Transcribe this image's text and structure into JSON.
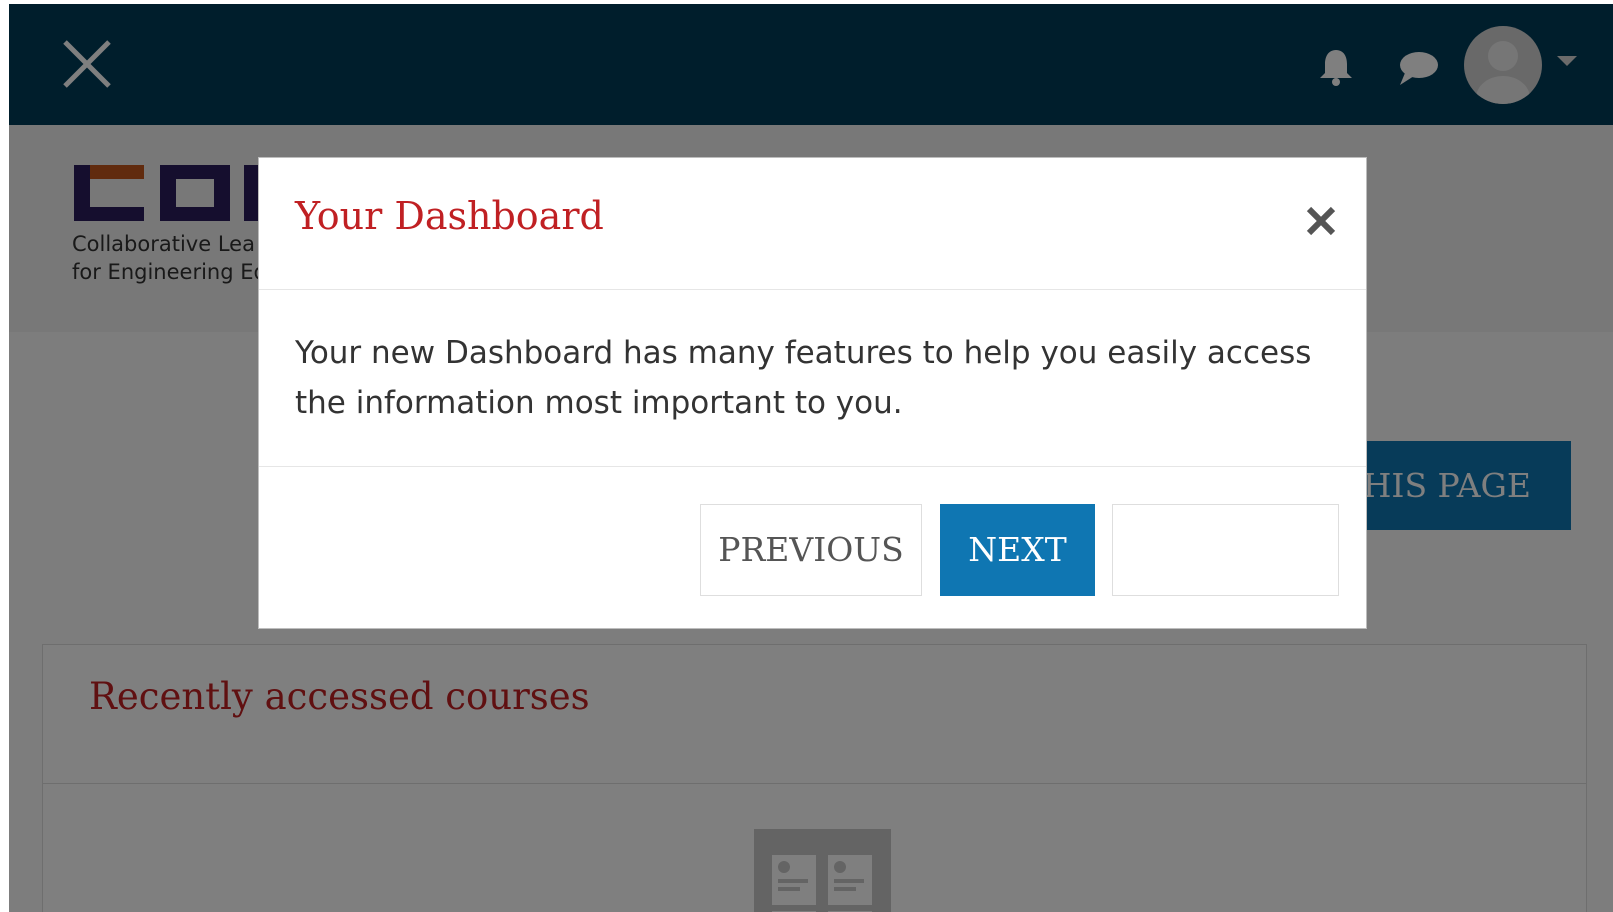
{
  "navbar": {
    "close_icon": "close-icon",
    "notifications_icon": "bell-icon",
    "messages_icon": "chat-icon",
    "user_menu_icon": "avatar",
    "caret_icon": "caret-down-icon"
  },
  "header": {
    "logo_text": "COL",
    "tagline_line1": "Collaborative Lea",
    "tagline_line2": "for Engineering Ed"
  },
  "page": {
    "customise_button_visible_text": "HIS PAGE"
  },
  "recent_courses": {
    "title": "Recently accessed courses",
    "empty_icon": "courses-placeholder-icon"
  },
  "modal": {
    "title": "Your Dashboard",
    "body": "Your new Dashboard has many features to help you easily access the information most important to you.",
    "previous_label": "PREVIOUS",
    "next_label": "NEXT",
    "end_label": ""
  },
  "colors": {
    "navbar": "#013c59",
    "accent_red": "#c02023",
    "primary_blue": "#0f76b2",
    "overlay": "rgba(0,0,0,0.5)"
  }
}
